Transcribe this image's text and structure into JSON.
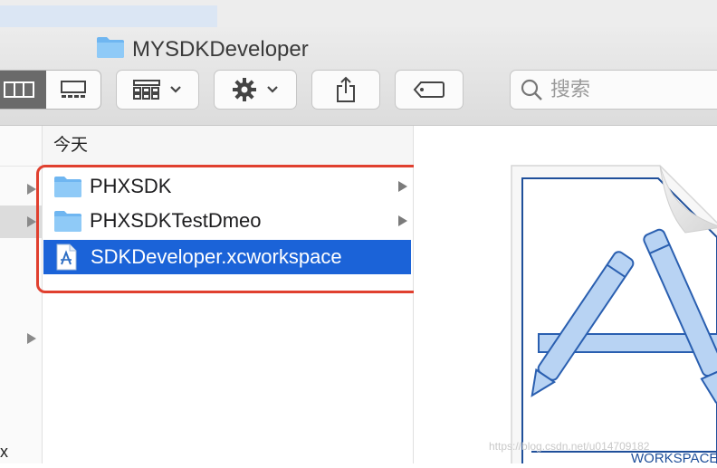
{
  "window": {
    "title": "MYSDKDeveloper",
    "folder_color": "#6fb6f1"
  },
  "toolbar": {
    "view_column": "column-view-icon",
    "view_gallery": "gallery-view-icon",
    "group_icon": "grid-icon",
    "action_icon": "gear-icon",
    "share_icon": "share-icon",
    "tag_icon": "tag-icon"
  },
  "search": {
    "placeholder": "搜索"
  },
  "column": {
    "header": "今天",
    "items": [
      {
        "label": "PHXSDK",
        "type": "folder",
        "has_children": true
      },
      {
        "label": "PHXSDKTestDmeo",
        "type": "folder",
        "has_children": true
      },
      {
        "label": "SDKDeveloper.xcworkspace",
        "type": "workspace",
        "selected": true
      }
    ]
  },
  "left_column": {
    "fragment": "x"
  },
  "preview": {
    "label": "WORKSPACE",
    "accent": "#1b63d8"
  },
  "watermark": "https://blog.csdn.net/u014709182",
  "colors": {
    "selection": "#1b63d8",
    "highlight_box": "#e0402f"
  }
}
